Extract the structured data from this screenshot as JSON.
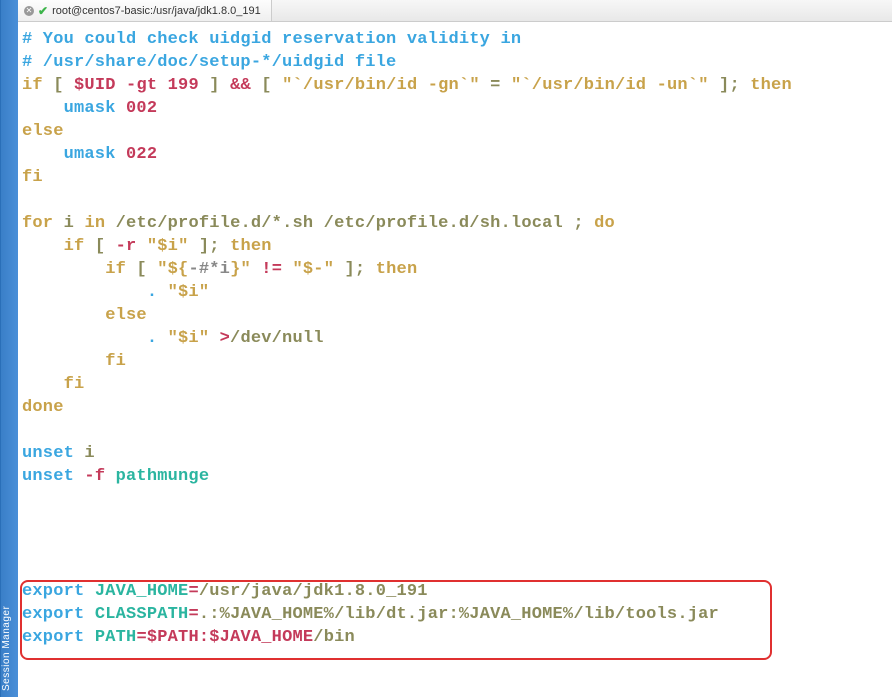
{
  "session_manager_label": "Session Manager",
  "tab": {
    "title": "root@centos7-basic:/usr/java/jdk1.8.0_191"
  },
  "code": {
    "l1": "# You could check uidgid reservation validity in",
    "l2": "# /usr/share/doc/setup-*/uidgid file",
    "l3_if": "if",
    "l3_lb1": " [ ",
    "l3_uid": "$UID",
    "l3_gt": " -gt ",
    "l3_199": "199",
    "l3_rb1": " ] ",
    "l3_and": "&&",
    "l3_lb2": " [ ",
    "l3_q1": "\"`/usr/bin/id -gn`\"",
    "l3_eq": " = ",
    "l3_q2": "\"`/usr/bin/id -un`\"",
    "l3_rb2": " ]",
    "l3_semi": "; ",
    "l3_then": "then",
    "l4_umask": "    umask ",
    "l4_002": "002",
    "l5_else": "else",
    "l6_umask": "    umask ",
    "l6_022": "022",
    "l7_fi": "fi",
    "l9_for": "for",
    "l9_i": " i ",
    "l9_in": "in",
    "l9_paths": " /etc/profile.d/*.sh /etc/profile.d/sh.local ",
    "l9_semi": "; ",
    "l9_do": "do",
    "l10_if": "    if",
    "l10_lb": " [ ",
    "l10_r": "-r ",
    "l10_q": "\"$i\"",
    "l10_rb": " ]",
    "l10_semi": "; ",
    "l10_then": "then",
    "l11_if": "        if",
    "l11_lb": " [ ",
    "l11_qa": "\"${",
    "l11_qm": "-#*i",
    "l11_qb": "}\"",
    "l11_ne": " != ",
    "l11_q2": "\"$-\"",
    "l11_rb": " ]",
    "l11_semi": "; ",
    "l11_then": "then",
    "l12_dot": "            . ",
    "l12_q": "\"$i\"",
    "l13_else": "        else",
    "l14_dot": "            . ",
    "l14_q": "\"$i\"",
    "l14_gt": " >",
    "l14_dn": "/dev/null",
    "l15_fi": "        fi",
    "l16_fi": "    fi",
    "l17_done": "done",
    "l19_unset": "unset",
    "l19_i": " i",
    "l20_unset": "unset",
    "l20_f": " -f ",
    "l20_pm": "pathmunge",
    "l25_export": "export",
    "l25_k": " JAVA_HOME",
    "l25_eq": "=",
    "l25_v": "/usr/java/jdk1.8.0_191",
    "l26_export": "export",
    "l26_k": " CLASSPATH",
    "l26_eq": "=",
    "l26_v": ".:%JAVA_HOME%/lib/dt.jar:%JAVA_HOME%/lib/tools.jar",
    "l27_export": "export",
    "l27_k": " PATH",
    "l27_eq": "=",
    "l27_v1": "$PATH",
    "l27_colon": ":",
    "l27_v2": "$JAVA_HOME",
    "l27_v3": "/bin"
  }
}
